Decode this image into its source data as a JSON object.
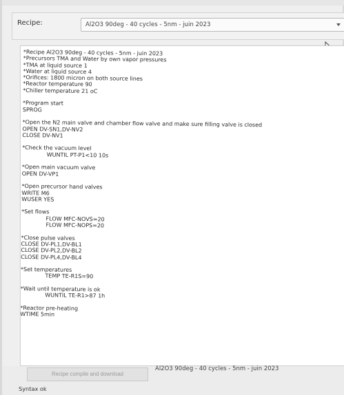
{
  "recipe": {
    "label": "Recipe:",
    "selected": "Al2O3 90deg - 40 cycles - 5nm - juin 2023"
  },
  "editor": {
    "lines": [
      "*Recipe Al2O3 90deg - 40 cycles - 5nm - juin 2023",
      "*Precursors TMA and Water by own vapor pressures",
      "*TMA at liquid source 1",
      "*Water at liquid source 4",
      "*Orifices: 1800 micron on both source lines",
      "*Reactor temperature 90",
      "*Chiller temperature 21 oC",
      "",
      "*Program start",
      "SPROG",
      "",
      "*Open the N2 main valve and chamber flow valve and make sure filling valve is closed",
      "OPEN DV-SN1,DV-NV2",
      "CLOSE DV-NV1",
      "",
      "*Check the vacuum level",
      "              WUNTIL PT-P1<10 10s",
      "",
      "*Open main vacuum valve",
      "OPEN DV-VP1",
      "",
      "*Open precursor hand valves",
      "WRITE M6",
      "WUSER YES",
      "",
      "*Set flows",
      "              FLOW MFC-NOVS=20",
      "              FLOW MFC-NOPS=20",
      "",
      "*Close pulse valves",
      "CLOSE DV-PL1,DV-BL1",
      "CLOSE DV-PL2,DV-BL2",
      "CLOSE DV-PL4,DV-BL4",
      "",
      "*Set temperatures",
      "              TEMP TE-R1S=90",
      "",
      "*Wait until temperature is ok",
      "              WUNTIL TE-R1>87 1h",
      "",
      "*Reactor pre-heating",
      "WTIME 5min"
    ]
  },
  "footer": {
    "compile_label": "Recipe compile and download",
    "compiled_recipe": "Al2O3 90deg - 40 cycles - 5nm - juin 2023",
    "status": "Syntax ok"
  }
}
